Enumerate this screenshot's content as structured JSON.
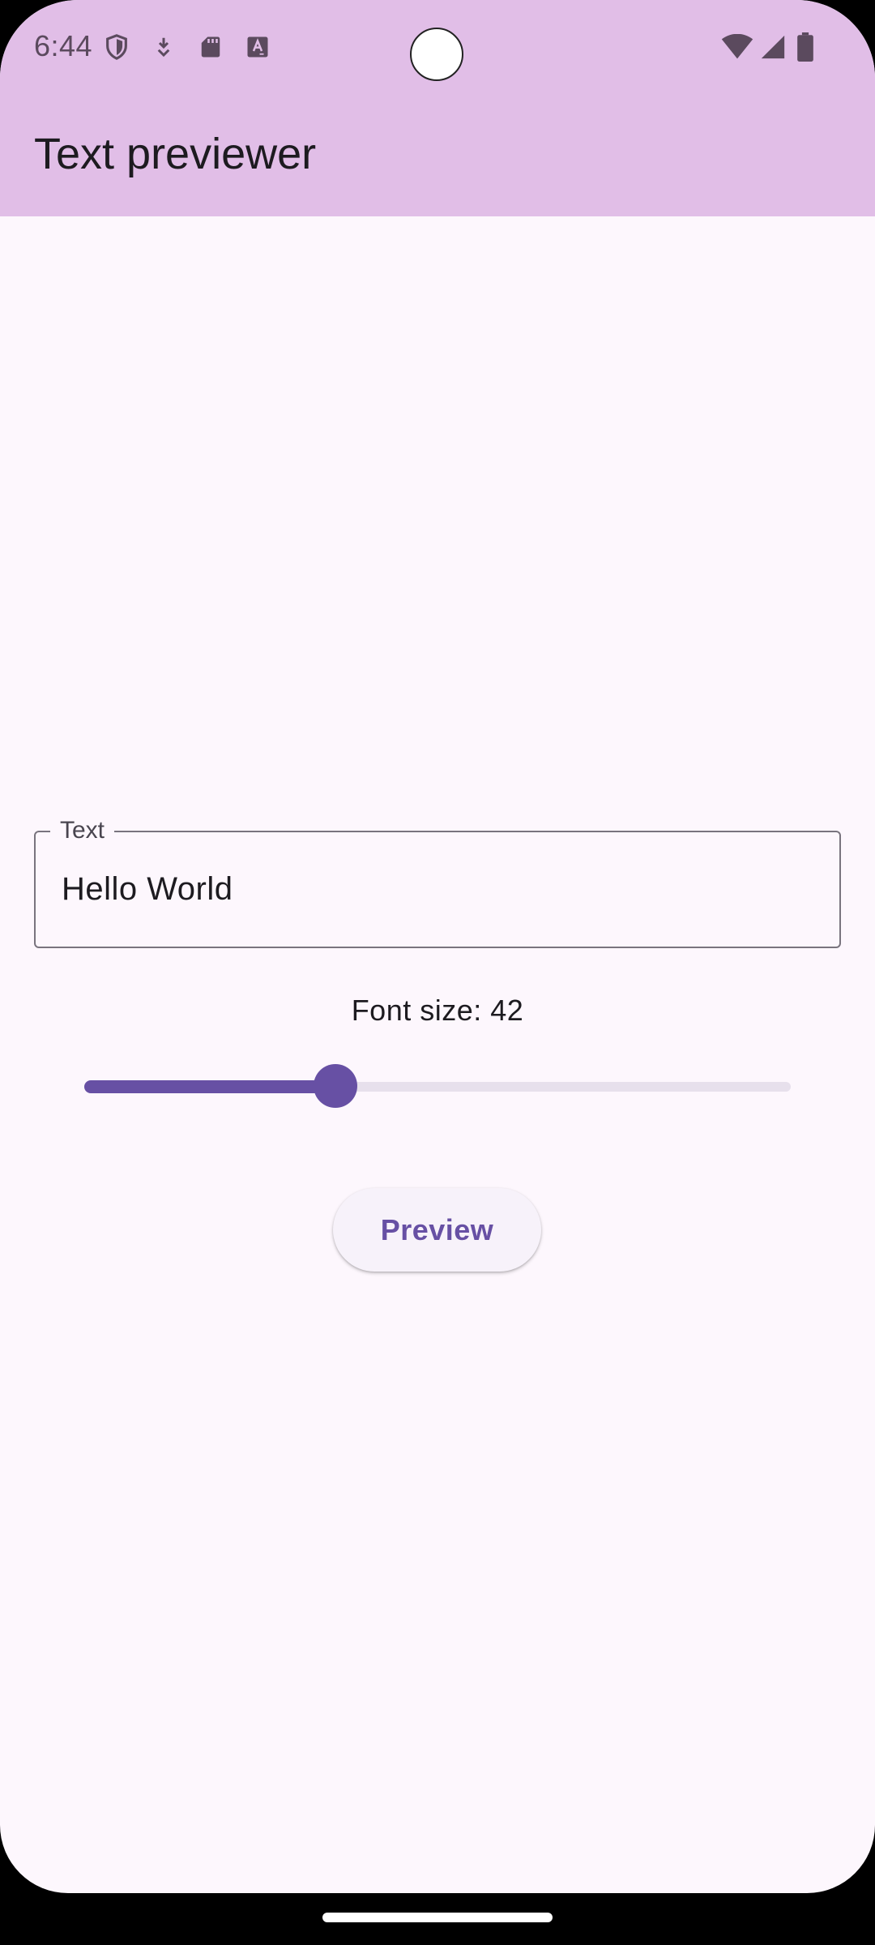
{
  "status_bar": {
    "time": "6:44",
    "icons_left": [
      "shield-icon",
      "download-icon",
      "sd-card-icon",
      "font-a-icon"
    ],
    "icons_right": [
      "wifi-icon",
      "signal-icon",
      "battery-icon"
    ]
  },
  "app_bar": {
    "title": "Text previewer",
    "color": "#e1bee7"
  },
  "text_field": {
    "label": "Text",
    "value": "Hello World"
  },
  "font_size": {
    "label": "Font size: 42",
    "slider_fraction": 0.355
  },
  "preview_button": {
    "label": "Preview"
  },
  "colors": {
    "accent": "#6750a4",
    "background": "#fdf7fd"
  }
}
